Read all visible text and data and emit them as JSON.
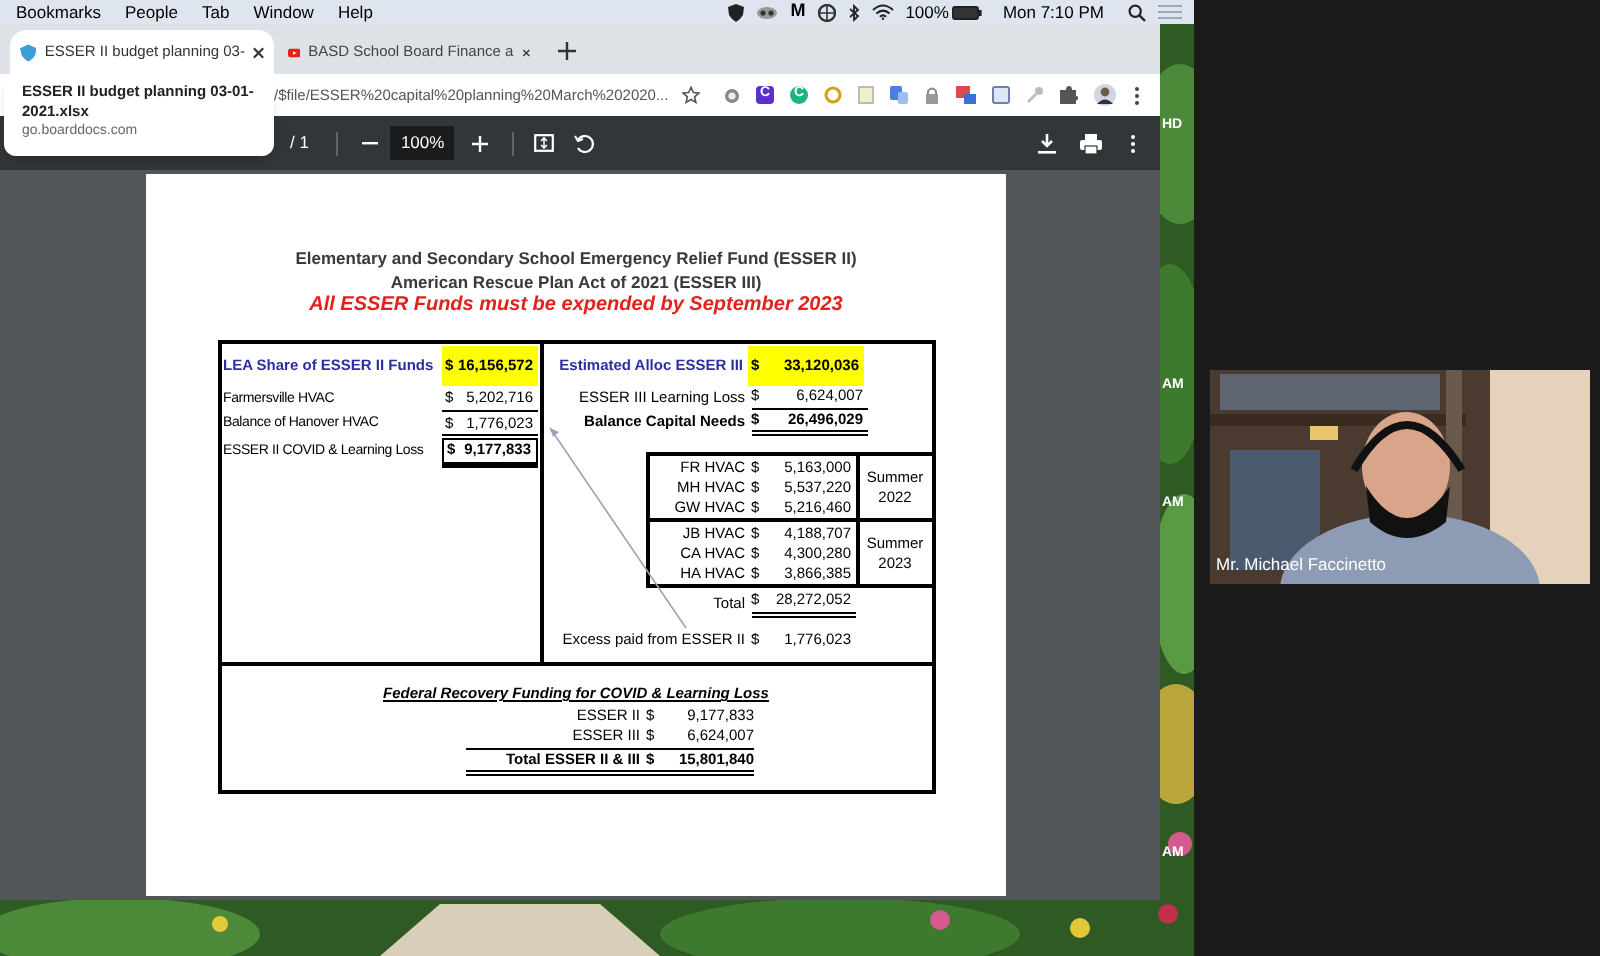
{
  "menubar": {
    "items": [
      "Bookmarks",
      "People",
      "Tab",
      "Window",
      "Help"
    ],
    "app_glyph": "M",
    "battery": "100%",
    "clock": "Mon 7:10 PM"
  },
  "tabs": [
    {
      "title": "ESSER II budget planning 03-",
      "selected": true,
      "kind": "document"
    },
    {
      "title": "BASD School Board Finance a",
      "selected": false,
      "kind": "video"
    }
  ],
  "address": "/$file/ESSER%20capital%20planning%20March%202020...",
  "extensions": [
    {
      "kind": "dot"
    },
    {
      "kind": "square-letter",
      "label": "C"
    },
    {
      "kind": "round-letter",
      "label": "C"
    },
    {
      "kind": "ring"
    },
    {
      "kind": "note"
    },
    {
      "kind": "translate"
    },
    {
      "kind": "lock"
    },
    {
      "kind": "badge"
    },
    {
      "kind": "calendar"
    },
    {
      "kind": "key"
    },
    {
      "kind": "puzzle"
    }
  ],
  "tooltip": {
    "title": "ESSER II budget planning 03-01-2021.xlsx",
    "domain": "go.boarddocs.com"
  },
  "pdf_toolbar": {
    "pages": "/ 1",
    "zoom": "100%"
  },
  "desktop_labels": [
    {
      "text": "HD",
      "kind": "top"
    },
    {
      "text": "AM",
      "kind": "mid1"
    },
    {
      "text": "AM",
      "kind": "mid2"
    },
    {
      "text": "AM",
      "kind": "low"
    }
  ],
  "document": {
    "title_lines": [
      "Elementary and Secondary School Emergency Relief Fund (ESSER II)",
      "American Rescue Plan Act of 2021 (ESSER III)"
    ],
    "deadline": "All ESSER Funds must be expended by September 2023",
    "left": {
      "header": {
        "label": "LEA Share of ESSER II Funds",
        "currency": "$",
        "amount": "16,156,572"
      },
      "rows": [
        {
          "label": "Farmersville HVAC",
          "currency": "$",
          "amount": "5,202,716",
          "total": false
        },
        {
          "label": "Balance of Hanover HVAC",
          "currency": "$",
          "amount": "1,776,023",
          "total": false
        },
        {
          "label": "ESSER II COVID & Learning Loss",
          "currency": "$",
          "amount": "9,177,833",
          "total": true
        }
      ]
    },
    "right": {
      "header": {
        "label": "Estimated Alloc ESSER III",
        "currency": "$",
        "amount": "33,120,036"
      },
      "rows": [
        {
          "label": "ESSER III Learning Loss",
          "currency": "$",
          "amount": "6,624,007",
          "bold": false
        },
        {
          "label": "Balance Capital Needs",
          "currency": "$",
          "amount": "26,496,029",
          "bold": true
        }
      ],
      "hvac_groups": [
        {
          "period": "Summer 2022",
          "rows": [
            {
              "label": "FR HVAC",
              "currency": "$",
              "amount": "5,163,000"
            },
            {
              "label": "MH HVAC",
              "currency": "$",
              "amount": "5,537,220"
            },
            {
              "label": "GW HVAC",
              "currency": "$",
              "amount": "5,216,460"
            }
          ]
        },
        {
          "period": "Summer 2023",
          "rows": [
            {
              "label": "JB HVAC",
              "currency": "$",
              "amount": "4,188,707"
            },
            {
              "label": "CA HVAC",
              "currency": "$",
              "amount": "4,300,280"
            },
            {
              "label": "HA HVAC",
              "currency": "$",
              "amount": "3,866,385"
            }
          ]
        }
      ],
      "total": {
        "label": "Total",
        "currency": "$",
        "amount": "28,272,052"
      },
      "excess": {
        "label": "Excess paid from ESSER II",
        "currency": "$",
        "amount": "1,776,023"
      }
    },
    "federal": {
      "title": "Federal Recovery Funding for COVID & Learning Loss",
      "rows": [
        {
          "label": "ESSER II",
          "currency": "$",
          "amount": "9,177,833",
          "bold": false
        },
        {
          "label": "ESSER III",
          "currency": "$",
          "amount": "6,624,007",
          "bold": false
        },
        {
          "label": "Total ESSER II & III",
          "currency": "$",
          "amount": "15,801,840",
          "bold": true
        }
      ]
    }
  },
  "participant": {
    "name": "Mr. Michael Faccinetto"
  }
}
